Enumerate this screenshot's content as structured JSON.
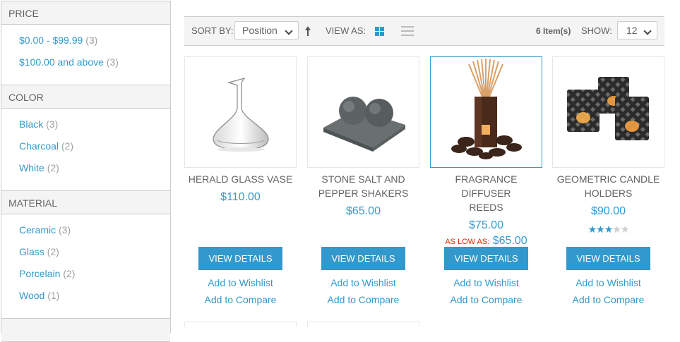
{
  "filters": [
    {
      "title": "PRICE",
      "items": [
        {
          "label": "$0.00 - $99.99",
          "count": "(3)"
        },
        {
          "label": "$100.00 and above",
          "count": "(3)"
        }
      ]
    },
    {
      "title": "COLOR",
      "items": [
        {
          "label": "Black",
          "count": "(3)"
        },
        {
          "label": "Charcoal",
          "count": "(2)"
        },
        {
          "label": "White",
          "count": "(2)"
        }
      ]
    },
    {
      "title": "MATERIAL",
      "items": [
        {
          "label": "Ceramic",
          "count": "(3)"
        },
        {
          "label": "Glass",
          "count": "(2)"
        },
        {
          "label": "Porcelain",
          "count": "(2)"
        },
        {
          "label": "Wood",
          "count": "(1)"
        }
      ]
    }
  ],
  "toolbar": {
    "sort_label": "SORT BY:",
    "sort_value": "Position",
    "view_label": "VIEW AS:",
    "items_count": "6 Item(s)",
    "show_label": "SHOW:",
    "show_value": "12"
  },
  "products": [
    {
      "name_line1": "HERALD GLASS VASE",
      "name_line2": "",
      "price": "$110.00",
      "as_low_label": "",
      "as_low_price": "",
      "rating": null,
      "button": "VIEW DETAILS",
      "wishlist": "Add to Wishlist",
      "compare": "Add to Compare"
    },
    {
      "name_line1": "STONE SALT AND",
      "name_line2": "PEPPER SHAKERS",
      "price": "$65.00",
      "as_low_label": "",
      "as_low_price": "",
      "rating": null,
      "button": "VIEW DETAILS",
      "wishlist": "Add to Wishlist",
      "compare": "Add to Compare"
    },
    {
      "name_line1": "FRAGRANCE DIFFUSER",
      "name_line2": "REEDS",
      "price": "$75.00",
      "as_low_label": "AS LOW AS:",
      "as_low_price": "$65.00",
      "rating": null,
      "button": "VIEW DETAILS",
      "wishlist": "Add to Wishlist",
      "compare": "Add to Compare"
    },
    {
      "name_line1": "GEOMETRIC CANDLE",
      "name_line2": "HOLDERS",
      "price": "$90.00",
      "as_low_label": "",
      "as_low_price": "",
      "rating": 3,
      "button": "VIEW DETAILS",
      "wishlist": "Add to Wishlist",
      "compare": "Add to Compare"
    }
  ]
}
